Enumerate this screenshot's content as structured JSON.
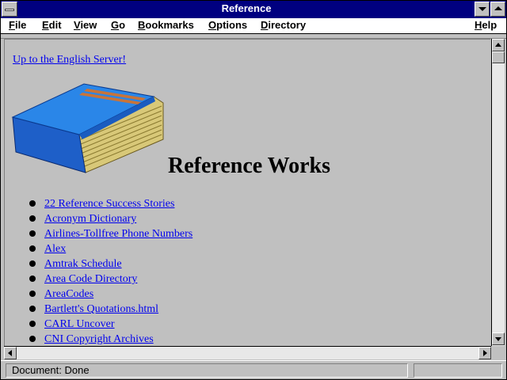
{
  "window": {
    "title": "Reference"
  },
  "menu": [
    {
      "key": "file",
      "label": "File",
      "u": "F",
      "rest": "ile"
    },
    {
      "key": "edit",
      "label": "Edit",
      "u": "E",
      "rest": "dit"
    },
    {
      "key": "view",
      "label": "View",
      "u": "V",
      "rest": "iew"
    },
    {
      "key": "go",
      "label": "Go",
      "u": "G",
      "rest": "o"
    },
    {
      "key": "bookmarks",
      "label": "Bookmarks",
      "u": "B",
      "rest": "ookmarks"
    },
    {
      "key": "options",
      "label": "Options",
      "u": "O",
      "rest": "ptions"
    },
    {
      "key": "directory",
      "label": "Directory",
      "u": "D",
      "rest": "irectory"
    },
    {
      "key": "help",
      "label": "Help",
      "u": "H",
      "rest": "elp"
    }
  ],
  "content": {
    "up_link": "Up to the English Server!",
    "heading": "Reference Works",
    "links": [
      "22 Reference Success Stories",
      "Acronym Dictionary",
      "Airlines-Tollfree Phone Numbers",
      "Alex",
      "Amtrak Schedule",
      "Area Code Directory",
      "AreaCodes",
      "Bartlett's Quotations.html",
      "CARL Uncover",
      "CNI Copyright Archives"
    ]
  },
  "status": {
    "text": "Document: Done"
  },
  "colors": {
    "titlebar": "#000080",
    "link": "#0000ee",
    "background": "#c0c0c0"
  },
  "icons": {
    "book": "book-icon"
  }
}
